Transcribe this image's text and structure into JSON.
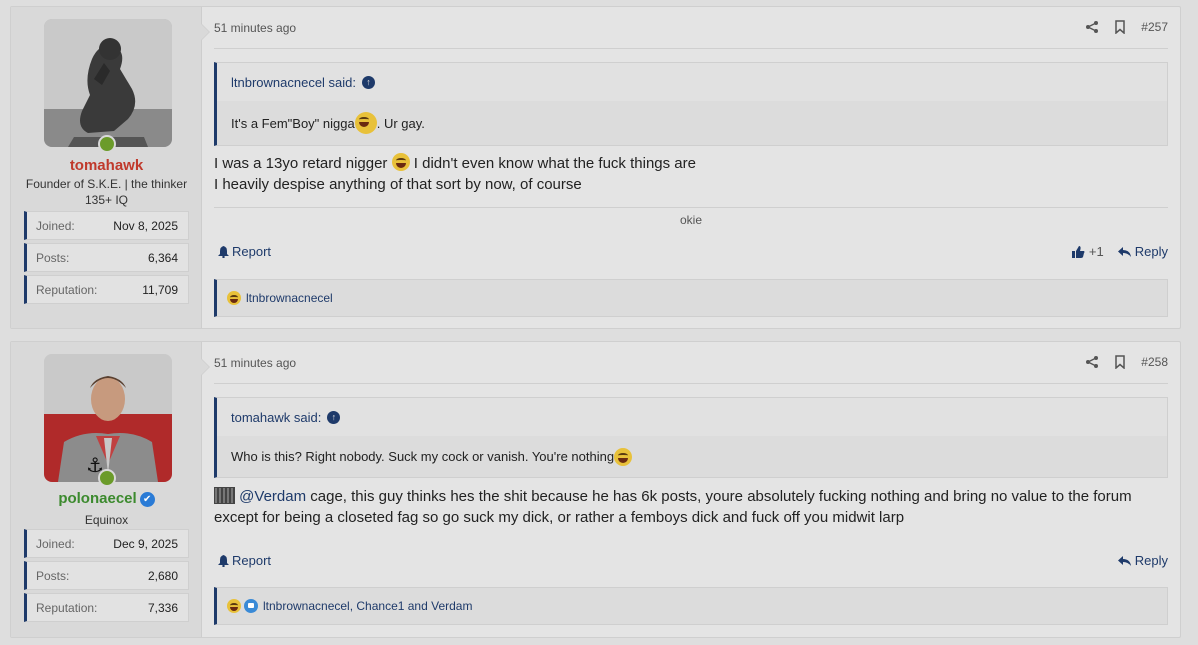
{
  "posts": [
    {
      "user": {
        "name": "tomahawk",
        "name_color": "#c0392b",
        "title_lines": [
          "Founder of S.K.E. | the thinker",
          "135+ IQ"
        ],
        "verified": false,
        "stats": [
          {
            "label": "Joined:",
            "value": "Nov 8, 2025"
          },
          {
            "label": "Posts:",
            "value": "6,364"
          },
          {
            "label": "Reputation:",
            "value": "11,709"
          }
        ]
      },
      "time": "51 minutes ago",
      "number": "#257",
      "quote": {
        "author": "ltnbrownacnecel said:",
        "text_before": "It's a Fem\"Boy\" nigga ",
        "text_after": ". Ur gay."
      },
      "message_lines": [
        {
          "before": "I was a 13yo retard nigger ",
          "after": " I didn't even know what the fuck things are"
        },
        {
          "before": "I heavily despise anything of that sort by now, of course",
          "after": ""
        }
      ],
      "signature": "okie",
      "report_label": "Report",
      "like_count": "+1",
      "reply_label": "Reply",
      "reactions_text": "ltnbrownacnecel"
    },
    {
      "user": {
        "name": "polonaecel",
        "name_color": "#3c8a2e",
        "title_lines": [
          "Equinox"
        ],
        "verified": true,
        "verified_icon": "✔",
        "stats": [
          {
            "label": "Joined:",
            "value": "Dec 9, 2025"
          },
          {
            "label": "Posts:",
            "value": "2,680"
          },
          {
            "label": "Reputation:",
            "value": "7,336"
          }
        ]
      },
      "time": "51 minutes ago",
      "number": "#258",
      "quote": {
        "author": "tomahawk said:",
        "text_before": "Who is this? Right nobody. Suck my cock or vanish. You're nothing ",
        "text_after": ""
      },
      "message": {
        "mention": "@Verdam",
        "line1_rest": " cage, this guy thinks hes the shit because he has 6k posts, youre absolutely fucking nothing and bring no value to the forum",
        "line2": "except for being a closeted fag so go suck my dick, or rather a femboys dick and fuck off you midwit larp"
      },
      "report_label": "Report",
      "reply_label": "Reply",
      "reactions_text": "ltnbrownacnecel, Chance1 and Verdam"
    }
  ],
  "icons": {
    "share": "share-icon",
    "bookmark": "bookmark-icon",
    "quote_up": "↑",
    "online": "online-indicator"
  }
}
